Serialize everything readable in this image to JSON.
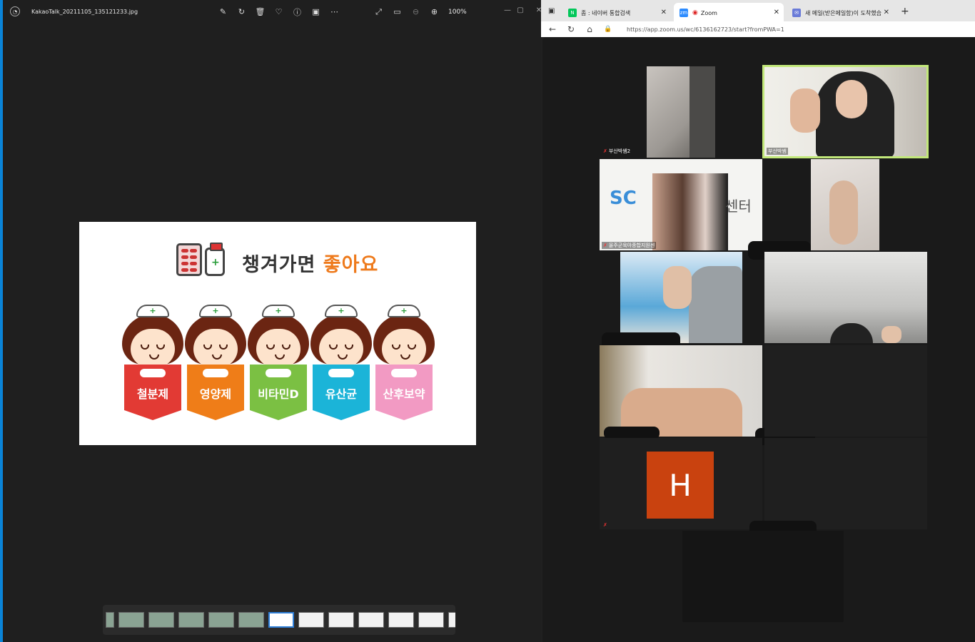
{
  "photos": {
    "filename": "KakaoTalk_20211105_135121233.jpg",
    "zoom_level": "100%",
    "slide": {
      "title_main": "챙겨가면",
      "title_accent": "좋아요",
      "nurses": [
        {
          "label": "철분제",
          "color": "#e23a34"
        },
        {
          "label": "영양제",
          "color": "#ef7d18"
        },
        {
          "label": "비타민D",
          "color": "#7bc043"
        },
        {
          "label": "유산균",
          "color": "#1bb4d8"
        },
        {
          "label": "산후보약",
          "color": "#f29ac3"
        }
      ]
    },
    "thumbnail_count": 12,
    "active_thumbnail_index": 5
  },
  "browser": {
    "tabs": [
      {
        "label": "좀 : 네이버 통합검색",
        "favicon_color": "#03c75a",
        "favicon_text": "N"
      },
      {
        "label": "Zoom",
        "favicon_color": "#2d8cff",
        "favicon_text": "zm"
      },
      {
        "label": "새 메일(받은메일함)이 도착했습",
        "favicon_color": "#6a7bd8",
        "favicon_text": "✉"
      }
    ],
    "url": "https://app.zoom.us/wc/6136162723/start?fromPWA=1"
  },
  "zoom": {
    "participants": [
      {
        "name": "부산박쌤2"
      },
      {
        "name": "부산박쌤"
      },
      {
        "name": "울주군육아종합지원센"
      },
      {
        "name": ""
      },
      {
        "name": ""
      },
      {
        "name": ""
      },
      {
        "name": ""
      },
      {
        "name": ""
      }
    ],
    "avatar_letter": "H",
    "center_text": "센터"
  }
}
